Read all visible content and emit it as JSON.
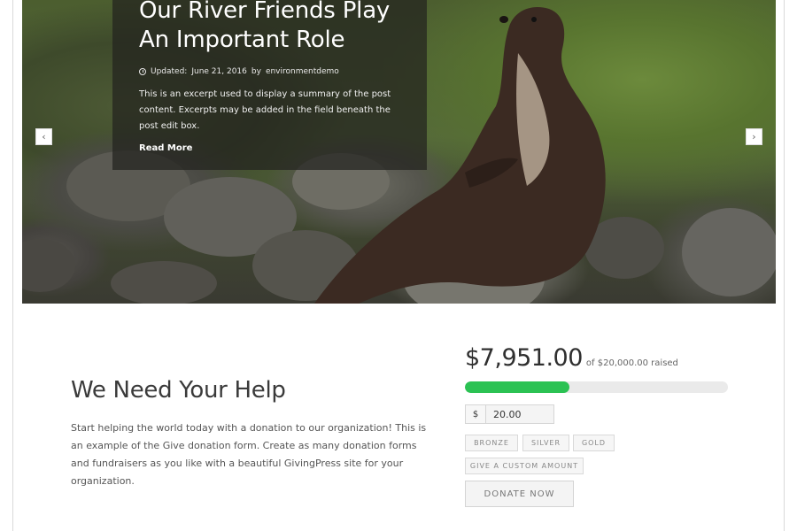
{
  "hero": {
    "title_line1": "Our River Friends Play",
    "title_line2": "An Important Role",
    "meta_prefix": "Updated:",
    "meta_date": "June 21, 2016",
    "meta_by": "by",
    "meta_author": "environmentdemo",
    "excerpt": "This is an excerpt used to display a summary of the post content. Excerpts may be added in the field beneath the post edit box.",
    "read_more": "Read More",
    "prev_icon": "chevron-left-icon",
    "next_icon": "chevron-right-icon"
  },
  "help": {
    "title": "We Need Your Help",
    "text": "Start helping the world today with a donation to our organization! This is an example of the Give donation form. Create as many donation forms and fundraisers as you like with a beautiful GivingPress site for your organization."
  },
  "donation": {
    "raised": "$7,951.00",
    "goal_text": "of $20,000.00 raised",
    "progress_fraction": 0.3976,
    "progress_color": "#2bc253",
    "currency": "$",
    "amount_value": "20.00",
    "levels": [
      "BRONZE",
      "SILVER",
      "GOLD"
    ],
    "custom_label": "GIVE A CUSTOM AMOUNT",
    "donate_label": "DONATE NOW"
  }
}
